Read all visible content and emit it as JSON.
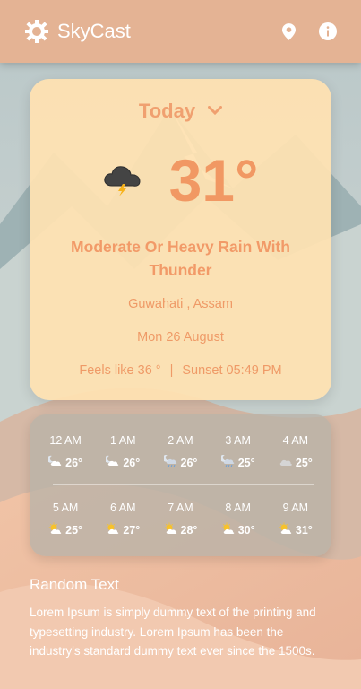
{
  "app": {
    "title": "SkyCast",
    "icons": [
      "sun-gear-icon",
      "location-icon",
      "info-icon"
    ]
  },
  "today": {
    "day_label": "Today",
    "temperature": "31°",
    "condition": "Moderate Or Heavy Rain With Thunder",
    "location": "Guwahati , Assam",
    "date": "Mon 26 August",
    "feels_like": "Feels like 36 °",
    "separator": "|",
    "sunset": "Sunset 05:49 PM"
  },
  "hourly": [
    {
      "time": "12 AM",
      "temp": "26°",
      "icon": "night-cloudy-icon"
    },
    {
      "time": "1 AM",
      "temp": "26°",
      "icon": "night-cloudy-icon"
    },
    {
      "time": "2 AM",
      "temp": "26°",
      "icon": "night-rain-icon"
    },
    {
      "time": "3 AM",
      "temp": "25°",
      "icon": "night-rain-icon"
    },
    {
      "time": "4 AM",
      "temp": "25°",
      "icon": "cloud-icon"
    },
    {
      "time": "5 AM",
      "temp": "25°",
      "icon": "partly-cloudy-icon"
    },
    {
      "time": "6 AM",
      "temp": "27°",
      "icon": "partly-cloudy-icon"
    },
    {
      "time": "7 AM",
      "temp": "28°",
      "icon": "partly-cloudy-icon"
    },
    {
      "time": "8 AM",
      "temp": "30°",
      "icon": "partly-cloudy-icon"
    },
    {
      "time": "9 AM",
      "temp": "31°",
      "icon": "partly-cloudy-icon"
    }
  ],
  "random_section": {
    "heading": "Random Text",
    "body": "Lorem Ipsum is simply dummy text of the printing and typesetting industry. Lorem Ipsum has been the industry's standard dummy text ever since the 1500s."
  },
  "colors": {
    "appbar": "#e4b394",
    "accent": "#f19863",
    "card": "#ffe2b2"
  }
}
